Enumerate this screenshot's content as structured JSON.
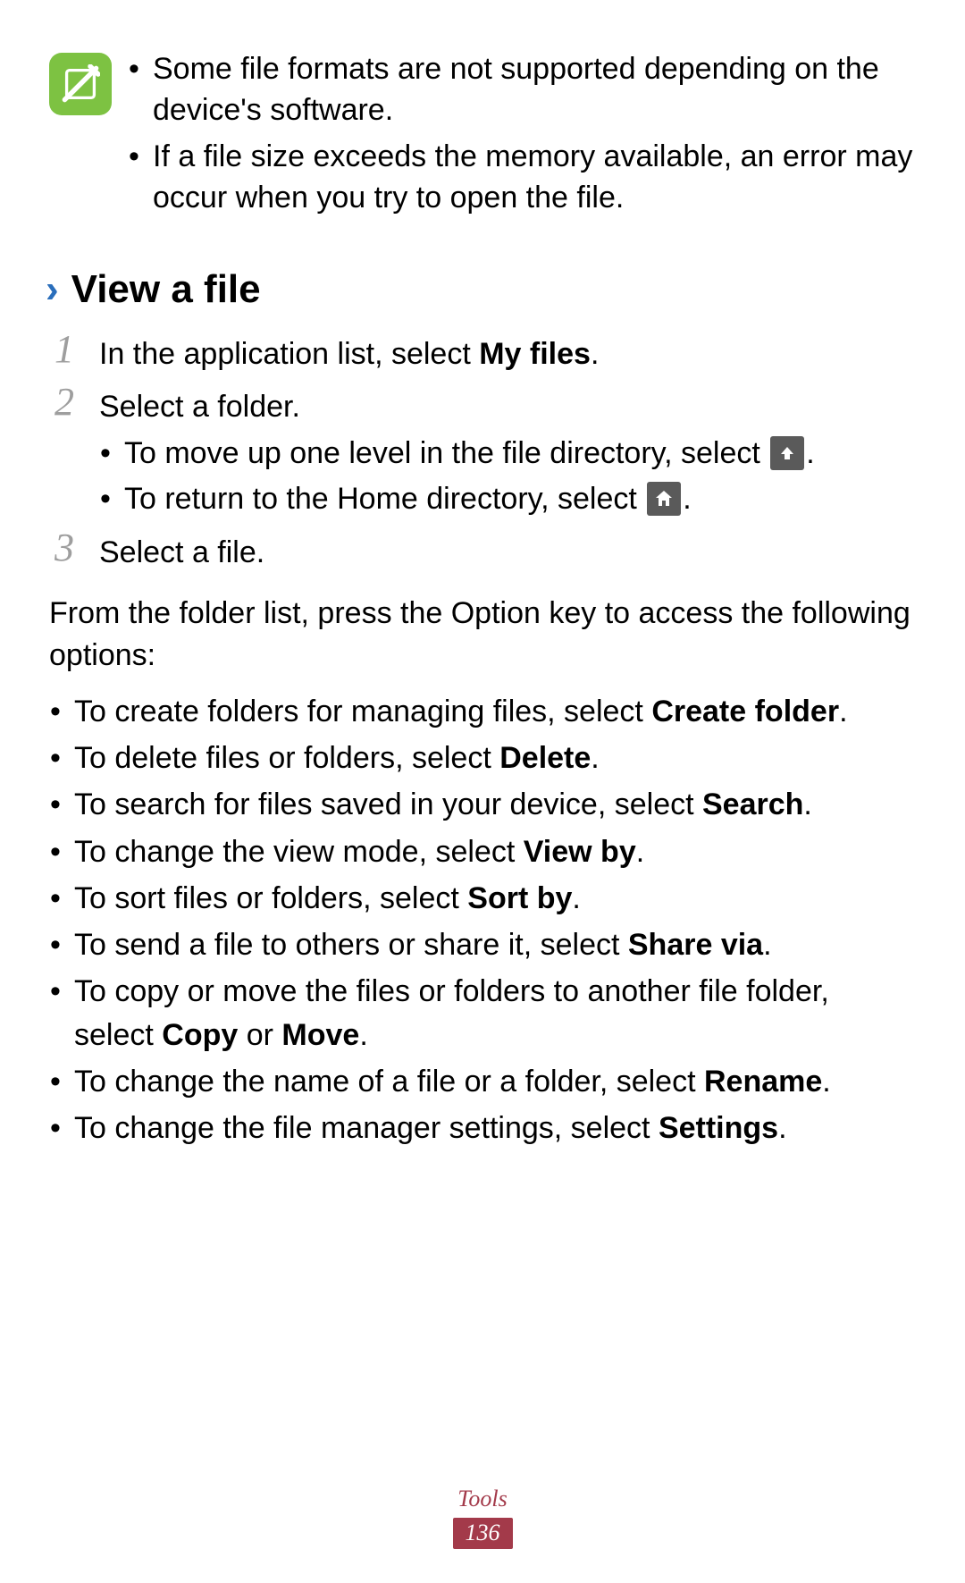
{
  "note": {
    "items": [
      "Some file formats are not supported depending on the device's software.",
      "If a file size exceeds the memory available, an error may occur when you try to open the file."
    ]
  },
  "section": {
    "chevron": "›",
    "title": "View a file"
  },
  "steps": [
    {
      "num": "1",
      "text_pre": "In the application list, select ",
      "bold": "My files",
      "text_post": "."
    },
    {
      "num": "2",
      "text_pre": "Select a folder.",
      "sub": [
        {
          "pre": "To move up one level in the file directory, select ",
          "icon": "up",
          "post": "."
        },
        {
          "pre": "To return to the Home directory, select ",
          "icon": "home",
          "post": "."
        }
      ]
    },
    {
      "num": "3",
      "text_pre": "Select a file."
    }
  ],
  "options_intro": "From the folder list, press the Option key to access the following options:",
  "options": [
    {
      "pre": "To create folders for managing files, select ",
      "bold": "Create folder",
      "post": "."
    },
    {
      "pre": "To delete files or folders, select ",
      "bold": "Delete",
      "post": "."
    },
    {
      "pre": "To search for files saved in your device, select ",
      "bold": "Search",
      "post": "."
    },
    {
      "pre": "To change the view mode, select ",
      "bold": "View by",
      "post": "."
    },
    {
      "pre": "To sort files or folders, select ",
      "bold": "Sort by",
      "post": "."
    },
    {
      "pre": "To send a file to others or share it, select ",
      "bold": "Share via",
      "post": "."
    },
    {
      "pre": "To copy or move the files or folders to another file folder, select ",
      "bold": "Copy",
      "mid": " or ",
      "bold2": "Move",
      "post": "."
    },
    {
      "pre": "To change the name of a file or a folder, select ",
      "bold": "Rename",
      "post": "."
    },
    {
      "pre": "To change the file manager settings, select ",
      "bold": "Settings",
      "post": "."
    }
  ],
  "footer": {
    "chapter": "Tools",
    "page": "136"
  }
}
